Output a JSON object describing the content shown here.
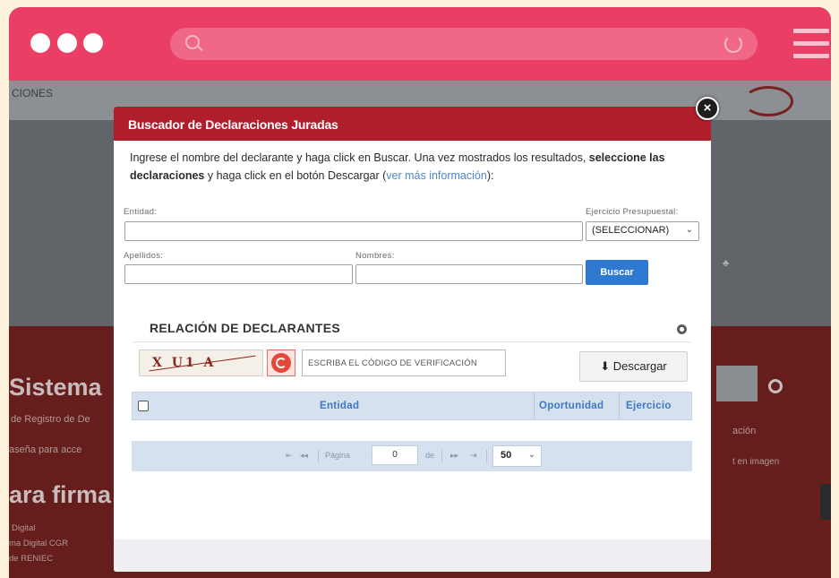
{
  "browser": {
    "traffic_lights": [
      "dot-1",
      "dot-2",
      "dot-3"
    ],
    "colors": {
      "bar": "#eb3e64",
      "url": "#f06787"
    }
  },
  "background_page": {
    "top_fragment": "CIONES",
    "heading_sistema": "Sistema",
    "line_registro": "de Registro de De",
    "line_contrasena": "aseña para acce",
    "heading_firma": "ara firma",
    "line_digital": "Digital",
    "line_firma_cgr": "ma Digital CGR",
    "line_renec": "de RENIEC",
    "right_accion": "ación",
    "right_imagen": "t en imagen"
  },
  "modal": {
    "title": "Buscador de Declaraciones Juradas",
    "desc_part1": "Ingrese el nombre del declarante y haga click en Buscar. Una vez mostrados los resultados, ",
    "desc_bold": "seleccione las declaraciones",
    "desc_part2": " y haga click en el botón Descargar (",
    "desc_link": "ver más información",
    "desc_part3": "):",
    "close_symbol": "×",
    "form": {
      "entidad_label": "Entidad:",
      "entidad_value": "",
      "ejercicio_label": "Ejercicio Presupuestal:",
      "ejercicio_value": "(SELECCIONAR)",
      "apellidos_label": "Apellidos:",
      "apellidos_value": "",
      "nombres_label": "Nombres:",
      "nombres_value": "",
      "buscar_label": "Buscar"
    },
    "section_title": "RELACIÓN DE DECLARANTES",
    "captcha_text": "X U1 A",
    "code_placeholder": "ESCRIBA EL CÓDIGO DE VERIFICACIÓN",
    "download_label": "Descargar",
    "table": {
      "columns": [
        "Entidad",
        "Oportunidad",
        "Ejercicio"
      ],
      "rows": []
    },
    "pager": {
      "first": "⇤",
      "prev": "◂◂",
      "page_label": "Página",
      "page_value": "0",
      "of_label": "de",
      "next": "▸▸",
      "last": "⇥",
      "page_size": "50"
    }
  },
  "accent_colors": {
    "header_red": "#b01e2c",
    "primary_blue": "#2f7ad0",
    "table_blue": "#d5e1ef"
  }
}
